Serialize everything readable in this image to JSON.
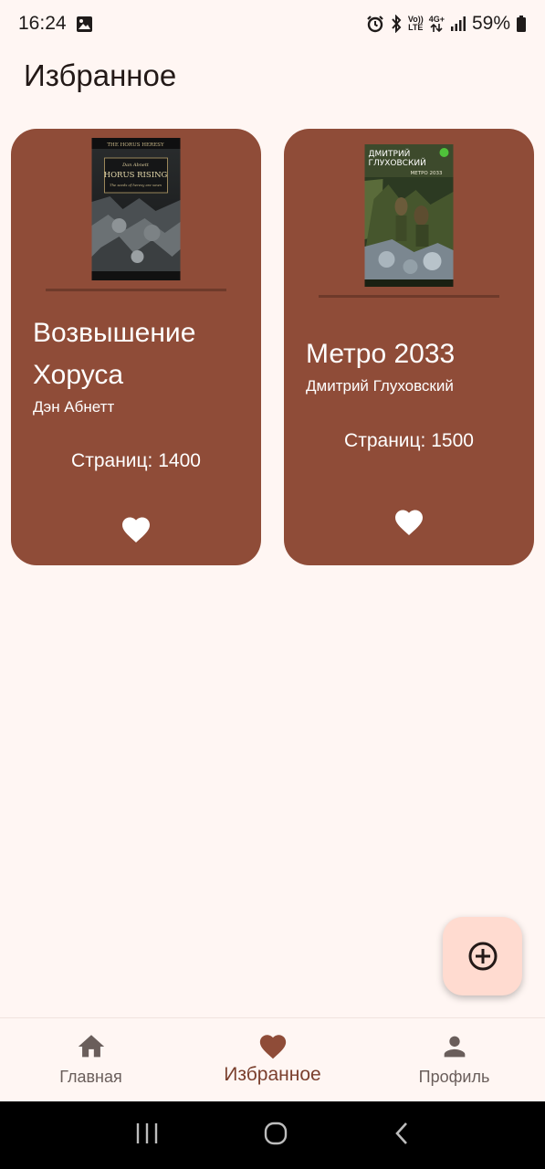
{
  "status_bar": {
    "time": "16:24",
    "network_label_top": "Vo))",
    "network_label_bottom": "LTE",
    "data_label": "4G+",
    "battery": "59%"
  },
  "page": {
    "title": "Избранное"
  },
  "books": [
    {
      "title": "Возвышение Хоруса",
      "author": "Дэн Абнетт",
      "pages": "Страниц: 1400",
      "cover": {
        "series": "THE HORUS HERESY",
        "author": "Dan Abnett",
        "title": "HORUS RISING",
        "tagline": "The seeds of heresy are sown"
      }
    },
    {
      "title": "Метро 2033",
      "author": "Дмитрий Глуховский",
      "pages": "Страниц: 1500",
      "cover": {
        "author_line1": "ДМИТРИЙ",
        "author_line2": "ГЛУХОВСКИЙ",
        "title": "МЕТРО 2033"
      }
    }
  ],
  "bottom_nav": [
    {
      "label": "Главная",
      "icon": "home-icon"
    },
    {
      "label": "Избранное",
      "icon": "heart-icon",
      "active": true
    },
    {
      "label": "Профиль",
      "icon": "person-icon"
    }
  ],
  "colors": {
    "background": "#fff6f3",
    "card": "#8f4c38",
    "fab": "#ffdbd0",
    "active_nav": "#8f4c38"
  }
}
